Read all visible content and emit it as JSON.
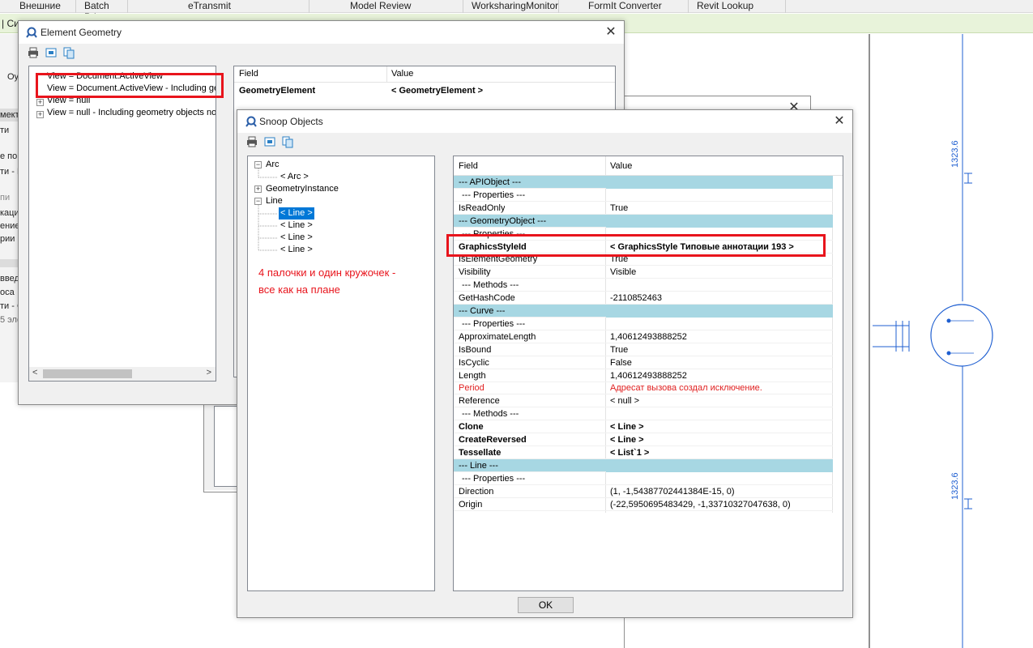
{
  "ribbon": {
    "tabs": [
      "Внешние",
      "Batch Print",
      "eTransmit",
      "Model Review",
      "WorksharingMonitor",
      "FormIt Converter",
      "Revit Lookup"
    ]
  },
  "strip_text": "| Сил",
  "left_panel": {
    "items": [
      "Оу",
      "мект",
      "ти",
      "е по",
      "ти - Н",
      "пи",
      "кация",
      "ение",
      "рии",
      "введ",
      "оса",
      "ти - С",
      "5 эле"
    ]
  },
  "canvas": {
    "dimension_labels": [
      "1323.6",
      "1323.6"
    ]
  },
  "element_geometry": {
    "title": "Element Geometry",
    "tree": [
      "View = Document.ActiveView",
      "View = Document.ActiveView - Including geom",
      "View = null",
      "View = null - Including geometry objects not set"
    ],
    "grid": {
      "field_header": "Field",
      "value_header": "Value",
      "rows": [
        {
          "field": "GeometryElement",
          "value": "< GeometryElement >"
        }
      ]
    }
  },
  "snoop": {
    "title": "Snoop Objects",
    "tree": {
      "arc": "Arc",
      "arc_child": "< Arc >",
      "geometry_instance": "GeometryInstance",
      "line": "Line",
      "line_children": [
        "< Line >",
        "< Line >",
        "< Line >",
        "< Line >"
      ]
    },
    "annotation": "4 палочки и один кружочек -\nвсе как на плане",
    "grid": {
      "field_header": "Field",
      "value_header": "Value",
      "rows": [
        {
          "field": "--- APIObject ---",
          "value": "",
          "kind": "group"
        },
        {
          "field": "--- Properties ---",
          "value": "",
          "kind": "sub"
        },
        {
          "field": "IsReadOnly",
          "value": "True",
          "kind": "normal"
        },
        {
          "field": "--- GeometryObject ---",
          "value": "",
          "kind": "group"
        },
        {
          "field": "--- Properties ---",
          "value": "",
          "kind": "sub"
        },
        {
          "field": "GraphicsStyleId",
          "value": "< GraphicsStyle  Типовые аннотации    193 >",
          "kind": "bold"
        },
        {
          "field": "IsElementGeometry",
          "value": "True",
          "kind": "normal"
        },
        {
          "field": "Visibility",
          "value": "Visible",
          "kind": "normal"
        },
        {
          "field": "--- Methods ---",
          "value": "",
          "kind": "sub"
        },
        {
          "field": "GetHashCode",
          "value": "-2110852463",
          "kind": "normal"
        },
        {
          "field": "--- Curve ---",
          "value": "",
          "kind": "group"
        },
        {
          "field": "--- Properties ---",
          "value": "",
          "kind": "sub"
        },
        {
          "field": "ApproximateLength",
          "value": "1,40612493888252",
          "kind": "normal"
        },
        {
          "field": "IsBound",
          "value": "True",
          "kind": "normal"
        },
        {
          "field": "IsCyclic",
          "value": "False",
          "kind": "normal"
        },
        {
          "field": "Length",
          "value": "1,40612493888252",
          "kind": "normal"
        },
        {
          "field": "Period",
          "value": "Адресат вызова создал исключение.",
          "kind": "error"
        },
        {
          "field": "Reference",
          "value": "< null >",
          "kind": "normal"
        },
        {
          "field": "--- Methods ---",
          "value": "",
          "kind": "sub"
        },
        {
          "field": "Clone",
          "value": "< Line >",
          "kind": "bold"
        },
        {
          "field": "CreateReversed",
          "value": "< Line >",
          "kind": "bold"
        },
        {
          "field": "Tessellate",
          "value": "< List`1 >",
          "kind": "bold"
        },
        {
          "field": "--- Line ---",
          "value": "",
          "kind": "group"
        },
        {
          "field": "--- Properties ---",
          "value": "",
          "kind": "sub"
        },
        {
          "field": "Direction",
          "value": "(1, -1,54387702441384E-15, 0)",
          "kind": "normal"
        },
        {
          "field": "Origin",
          "value": "(-22,5950695483429, -1,33710327047638, 0)",
          "kind": "normal"
        }
      ]
    },
    "ok_label": "OK"
  },
  "colors": {
    "group_band": "#a7d7e3",
    "annotation_red": "#e8141c",
    "selection_blue": "#0078d7",
    "drawing_blue": "#1f5fd1"
  }
}
